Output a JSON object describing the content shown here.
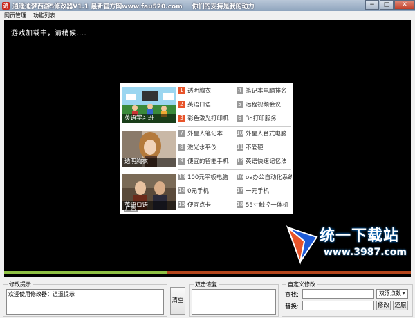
{
  "window": {
    "app_icon_text": "逍",
    "title": "逍遥迪梦西游5修改器V1.1  最新官方网www.fau520.com",
    "slogan": "你们的支持是我的动力",
    "buttons": {
      "minimize": "−",
      "maximize": "□",
      "close": "✕"
    }
  },
  "menu": [
    "网页管理",
    "功能列表"
  ],
  "game": {
    "loading_text": "游戏加载中，请稍候....",
    "ads": [
      {
        "caption": "英语学习班",
        "items": [
          {
            "num": "1",
            "label": "透明胸衣",
            "hot": true
          },
          {
            "num": "4",
            "label": "笔记本电脑排名",
            "hot": false
          },
          {
            "num": "2",
            "label": "英语口语",
            "hot": true
          },
          {
            "num": "5",
            "label": "远程视频会议",
            "hot": false
          },
          {
            "num": "3",
            "label": "彩色激光打印机",
            "hot": true
          },
          {
            "num": "6",
            "label": "3d打印服务",
            "hot": false
          }
        ]
      },
      {
        "caption": "透明胸衣",
        "items": [
          {
            "num": "7",
            "label": "外星人笔记本",
            "hot": false
          },
          {
            "num": "10",
            "label": "外星人台式电脑",
            "hot": false
          },
          {
            "num": "8",
            "label": "激光水平仪",
            "hot": false
          },
          {
            "num": "11",
            "label": "不爱硬",
            "hot": false
          },
          {
            "num": "9",
            "label": "便宜的智能手机",
            "hot": false
          },
          {
            "num": "12",
            "label": "英语快速记忆法",
            "hot": false
          }
        ]
      },
      {
        "caption": "英语口语",
        "items": [
          {
            "num": "13",
            "label": "100元平板电脑",
            "hot": false
          },
          {
            "num": "16",
            "label": "oa办公自动化系统",
            "hot": false
          },
          {
            "num": "14",
            "label": "0元手机",
            "hot": false
          },
          {
            "num": "17",
            "label": "一元手机",
            "hot": false
          },
          {
            "num": "15",
            "label": "便宜点卡",
            "hot": false
          },
          {
            "num": "18",
            "label": "55寸触控一体机",
            "hot": false
          }
        ]
      }
    ],
    "ad_badge": "广告",
    "watermark": {
      "title": "统一下载站",
      "url": "www.3987.com"
    },
    "progress_fraction": 0.4
  },
  "bottom": {
    "hint_group_label": "修改提示",
    "hint_text": "欢迎使用修改器：逍遥提示",
    "clear_button": "清空",
    "double_click_group_label": "双击恢复",
    "custom_group_label": "自定义修改",
    "search_label": "查找:",
    "replace_label": "替换:",
    "search_value": "",
    "replace_value": "",
    "type_select": "双浮点数",
    "modify_button": "修改",
    "restore_button": "还原"
  },
  "colors": {
    "hot_badge": "#e8542a",
    "progress_done": "#8fc244",
    "progress_rest": "#b5461c"
  }
}
